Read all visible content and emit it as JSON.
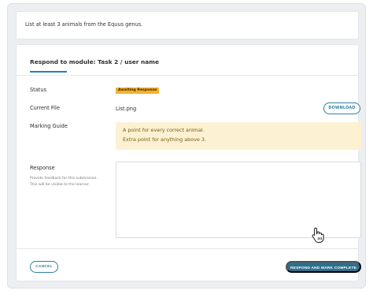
{
  "task": {
    "prompt": "List at least 3 animals from the Equus genus."
  },
  "module": {
    "heading": "Respond to module: Task 2 / user name"
  },
  "fields": {
    "status_label": "Status",
    "status_value": "Awaiting Response",
    "current_file_label": "Current File",
    "current_file_value": "List.png",
    "download_label": "DOWNLOAD",
    "marking_guide_label": "Marking Guide",
    "marking_guide_lines": [
      "A point for every correct animal.",
      "Extra point for anything above 3."
    ],
    "response_label": "Response",
    "response_help_lines": [
      "Provide feedback for this submission.",
      "This will be visible to the learner."
    ],
    "response_value": ""
  },
  "actions": {
    "cancel_label": "CANCEL",
    "submit_label": "RESPOND AND MARK COMPLETE"
  },
  "colors": {
    "accent": "#2f7fa3",
    "primary_button": "#2e6f8c",
    "status_badge": "#f2b230",
    "guide_background": "#fcf1d2"
  },
  "icons": {
    "cursor": "hand-pointer-icon"
  }
}
